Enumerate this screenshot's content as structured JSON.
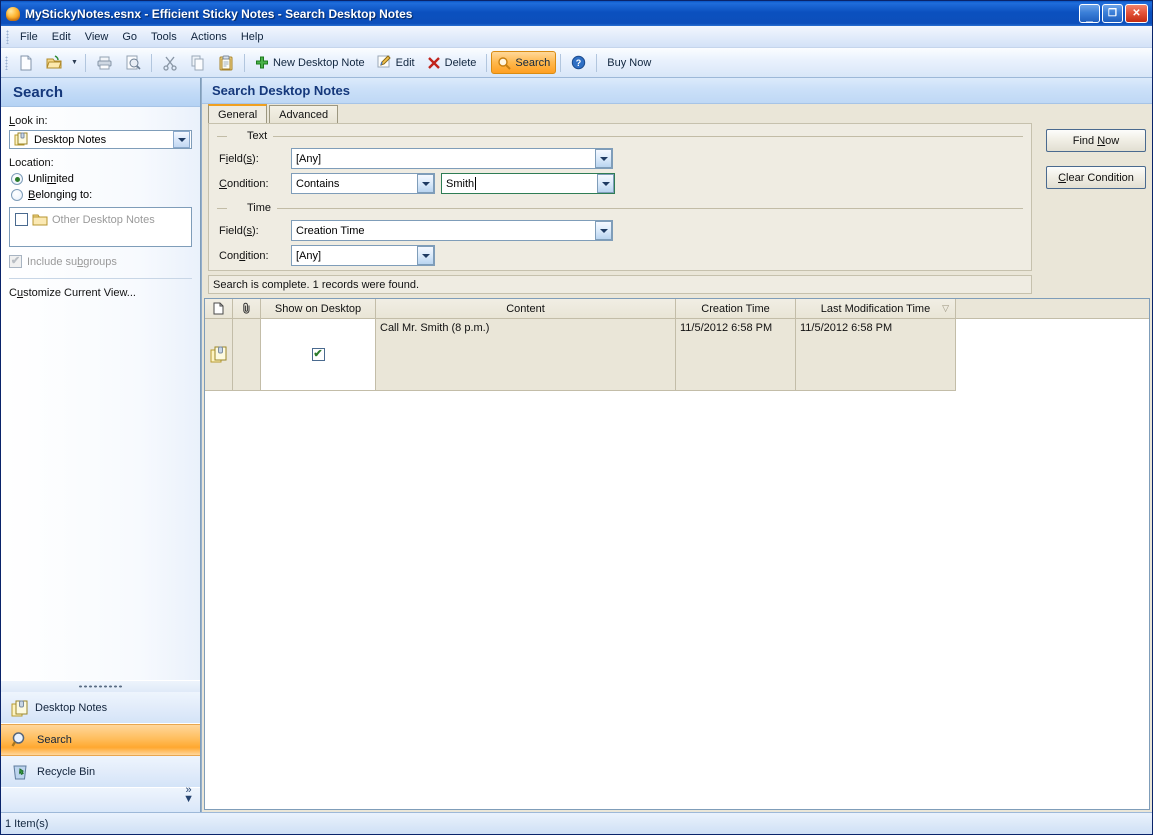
{
  "window": {
    "title": "MyStickyNotes.esnx - Efficient Sticky Notes - Search Desktop Notes",
    "icon": "sticky-note-bulb-icon",
    "minimize_label": "_",
    "restore_label": "❐",
    "close_label": "✕"
  },
  "menu": {
    "items": [
      {
        "label": "File"
      },
      {
        "label": "Edit"
      },
      {
        "label": "View"
      },
      {
        "label": "Go"
      },
      {
        "label": "Tools"
      },
      {
        "label": "Actions"
      },
      {
        "label": "Help"
      }
    ]
  },
  "toolbar": {
    "buttons": [
      {
        "name": "new-file",
        "icon": "new-document-icon",
        "label": ""
      },
      {
        "name": "open-file",
        "icon": "open-folder-icon",
        "label": "",
        "has_dropdown": true
      },
      {
        "name": "print",
        "icon": "printer-icon",
        "label": ""
      },
      {
        "name": "print-preview",
        "icon": "print-preview-icon",
        "label": ""
      },
      {
        "name": "cut",
        "icon": "scissors-icon",
        "label": ""
      },
      {
        "name": "copy",
        "icon": "copy-icon",
        "label": ""
      },
      {
        "name": "paste",
        "icon": "clipboard-paste-icon",
        "label": ""
      },
      {
        "name": "new-desktop-note",
        "icon": "green-plus-icon",
        "label": "New Desktop Note"
      },
      {
        "name": "edit",
        "icon": "pencil-icon",
        "label": "Edit"
      },
      {
        "name": "delete",
        "icon": "red-x-icon",
        "label": "Delete"
      },
      {
        "name": "search",
        "icon": "magnifier-icon",
        "label": "Search",
        "active": true
      },
      {
        "name": "help",
        "icon": "help-question-icon",
        "label": ""
      },
      {
        "name": "buy-now",
        "icon": "",
        "label": "Buy Now"
      }
    ]
  },
  "sidebar": {
    "header": "Search",
    "look_in_label": "Look in:",
    "look_in_value": "Desktop Notes",
    "look_in_icon": "desktop-notes-icon",
    "location_label": "Location:",
    "radio_unlimited": "Unlimited",
    "radio_belonging": "Belonging to:",
    "selected_radio": "Unlimited",
    "group_item": "Other Desktop Notes",
    "group_item_icon": "folder-icon",
    "group_item_checked": false,
    "include_subgroups": "Include subgroups",
    "include_subgroups_checked": true,
    "customize_link": "Customize Current View...",
    "nav": [
      {
        "label": "Desktop Notes",
        "icon": "desktop-notes-icon",
        "selected": false
      },
      {
        "label": "Search",
        "icon": "magnifier-icon",
        "selected": true
      },
      {
        "label": "Recycle Bin",
        "icon": "recycle-bin-icon",
        "selected": false
      }
    ],
    "expand_label": "»"
  },
  "main": {
    "header": "Search Desktop Notes",
    "tabs": [
      {
        "label": "General",
        "active": true
      },
      {
        "label": "Advanced",
        "active": false
      }
    ],
    "text_group": {
      "legend": "Text",
      "field_label": "Field(s):",
      "field_value": "[Any]",
      "condition_label": "Condition:",
      "condition_value": "Contains",
      "keyword_value": "Smith"
    },
    "time_group": {
      "legend": "Time",
      "field_label": "Field(s):",
      "field_value": "Creation Time",
      "condition_label": "Condition:",
      "condition_value": "[Any]"
    },
    "buttons": {
      "find_now": "Find Now",
      "clear_condition": "Clear Condition"
    },
    "result_status": "Search is complete. 1 records were found."
  },
  "grid": {
    "columns": [
      {
        "label": "",
        "name": "note-type-column",
        "icon": "document-icon"
      },
      {
        "label": "",
        "name": "attachment-column",
        "icon": "paperclip-icon"
      },
      {
        "label": "Show on Desktop",
        "name": "show-on-desktop-column"
      },
      {
        "label": "Content",
        "name": "content-column"
      },
      {
        "label": "Creation Time",
        "name": "creation-time-column"
      },
      {
        "label": "Last Modification Time",
        "name": "last-modification-time-column",
        "sorted": "desc",
        "sort_glyph": "▽"
      }
    ],
    "rows": [
      {
        "icon": "sticky-note-icon",
        "attachment": "",
        "show_on_desktop": true,
        "content": "Call Mr. Smith (8 p.m.)",
        "creation_time": "11/5/2012 6:58 PM",
        "last_modification_time": "11/5/2012 6:58 PM"
      }
    ],
    "check_glyph": "✔"
  },
  "statusbar": {
    "text": "1 Item(s)"
  },
  "colors": {
    "titlebar_blue": "#0b50bf",
    "accent_orange": "#ffa830",
    "panel_beige": "#eae6d8",
    "sidebar_header_blue": "#15387b",
    "focus_green": "#2e7d54",
    "close_red": "#c32c12"
  }
}
